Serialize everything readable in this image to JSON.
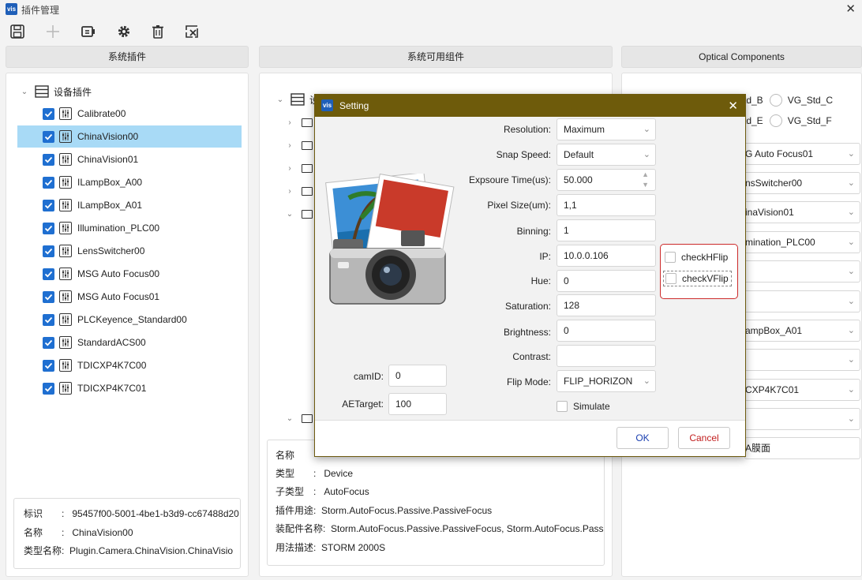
{
  "window": {
    "title": "插件管理",
    "app_icon": "vis"
  },
  "toolbar": {
    "icons": [
      "save-icon",
      "add-icon",
      "device-icon",
      "gear-icon",
      "trash-icon",
      "clear-icon"
    ]
  },
  "columns": {
    "left_header": "系统插件",
    "middle_header": "系统可用组件",
    "right_header": "Optical Components"
  },
  "tree": {
    "root_label": "设备插件",
    "items": [
      "Calibrate00",
      "ChinaVision00",
      "ChinaVision01",
      "ILampBox_A00",
      "ILampBox_A01",
      "Illumination_PLC00",
      "LensSwitcher00",
      "MSG Auto Focus00",
      "MSG Auto Focus01",
      "PLCKeyence_Standard00",
      "StandardACS00",
      "TDICXP4K7C00",
      "TDICXP4K7C01"
    ],
    "selected_index": 1
  },
  "left_info": {
    "id_key": "标识",
    "id_value": "95457f00-5001-4be1-b3d9-cc67488d20",
    "name_key": "名称",
    "name_value": "ChinaVision00",
    "type_key": "类型名称",
    "type_value": "Plugin.Camera.ChinaVision.ChinaVisio"
  },
  "middle_tree": {
    "root_label": "设"
  },
  "middle_info": {
    "name_key": "名称",
    "type_key": "类型",
    "type_value": "Device",
    "subtype_key": "子类型",
    "subtype_value": "AutoFocus",
    "usage_key": "插件用途",
    "usage_value": "Storm.AutoFocus.Passive.PassiveFocus",
    "assembly_key": "装配件名称",
    "assembly_value": "Storm.AutoFocus.Passive.PassiveFocus, Storm.AutoFocus.Passiv",
    "method_key": "用法描述",
    "method_value": "STORM 2000S"
  },
  "right_panel": {
    "radios": [
      "td_B",
      "VG_Std_C",
      "td_E",
      "VG_Std_F"
    ],
    "combos": [
      "G Auto Focus01",
      "nsSwitcher00",
      "inaVision01",
      "mination_PLC00",
      "",
      "",
      "ampBox_A01",
      "",
      "CXP4K7C01",
      ""
    ],
    "bottom_text": "A膜面"
  },
  "dialog": {
    "title": "Setting",
    "resolution_label": "Resolution:",
    "resolution_value": "Maximum",
    "snap_label": "Snap Speed:",
    "snap_value": "Default",
    "exposure_label": "Expsoure Time(us):",
    "exposure_value": "50.000",
    "pixel_label": "Pixel Size(um):",
    "pixel_value": "1,1",
    "binning_label": "Binning:",
    "binning_value": "1",
    "ip_label": "IP:",
    "ip_value": "10.0.0.106",
    "hue_label": "Hue:",
    "hue_value": "0",
    "saturation_label": "Saturation:",
    "saturation_value": "128",
    "brightness_label": "Brightness:",
    "brightness_value": "0",
    "contrast_label": "Contrast:",
    "contrast_value": "",
    "flip_label": "Flip Mode:",
    "flip_value": "FLIP_HORIZON",
    "simulate_label": "Simulate",
    "camid_label": "camID:",
    "camid_value": "0",
    "aetarget_label": "AETarget:",
    "aetarget_value": "100",
    "hflip_label": "checkHFlip",
    "vflip_label": "checkVFlip",
    "ok_label": "OK",
    "cancel_label": "Cancel",
    "ok_color": "#1a3fb0",
    "cancel_color": "#c21f1f"
  }
}
